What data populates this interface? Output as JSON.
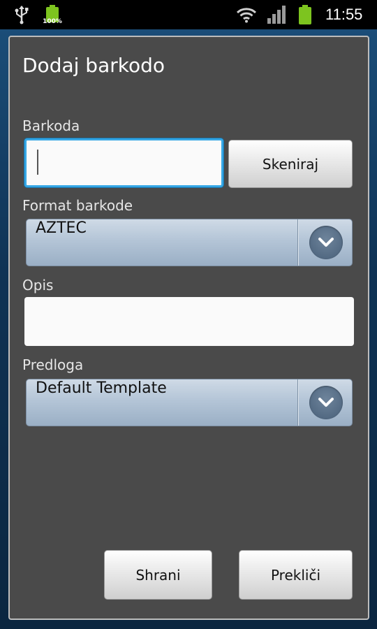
{
  "status_bar": {
    "battery_left_label": "100%",
    "time": "11:55",
    "icons": [
      "usb-icon",
      "battery-charging-icon",
      "wifi-icon",
      "signal-icon",
      "battery-icon"
    ]
  },
  "dialog": {
    "title": "Dodaj barkodo",
    "barcode": {
      "label": "Barkoda",
      "value": "",
      "scan_button": "Skeniraj"
    },
    "format": {
      "label": "Format barkode",
      "selected": "AZTEC"
    },
    "description": {
      "label": "Opis",
      "value": ""
    },
    "template": {
      "label": "Predloga",
      "selected": "Default Template"
    },
    "save_button": "Shrani",
    "cancel_button": "Prekliči"
  },
  "colors": {
    "dialog_bg": "#4a4a4a",
    "focus_accent": "#35a7e6",
    "battery_green": "#7dc41f"
  }
}
